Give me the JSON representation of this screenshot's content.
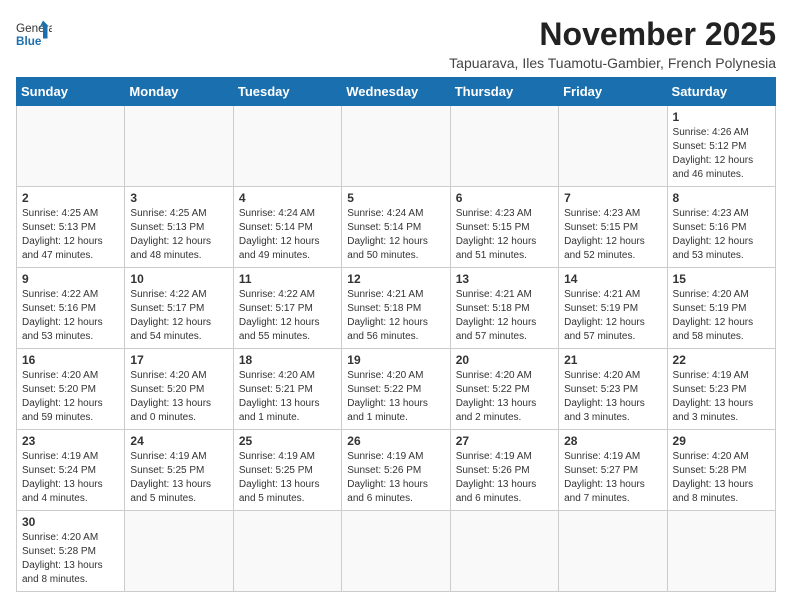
{
  "header": {
    "logo_line1": "General",
    "logo_line2": "Blue",
    "month_title": "November 2025",
    "subtitle": "Tapuarava, Iles Tuamotu-Gambier, French Polynesia"
  },
  "weekdays": [
    "Sunday",
    "Monday",
    "Tuesday",
    "Wednesday",
    "Thursday",
    "Friday",
    "Saturday"
  ],
  "weeks": [
    [
      {
        "day": "",
        "info": ""
      },
      {
        "day": "",
        "info": ""
      },
      {
        "day": "",
        "info": ""
      },
      {
        "day": "",
        "info": ""
      },
      {
        "day": "",
        "info": ""
      },
      {
        "day": "",
        "info": ""
      },
      {
        "day": "1",
        "info": "Sunrise: 4:26 AM\nSunset: 5:12 PM\nDaylight: 12 hours and 46 minutes."
      }
    ],
    [
      {
        "day": "2",
        "info": "Sunrise: 4:25 AM\nSunset: 5:13 PM\nDaylight: 12 hours and 47 minutes."
      },
      {
        "day": "3",
        "info": "Sunrise: 4:25 AM\nSunset: 5:13 PM\nDaylight: 12 hours and 48 minutes."
      },
      {
        "day": "4",
        "info": "Sunrise: 4:24 AM\nSunset: 5:14 PM\nDaylight: 12 hours and 49 minutes."
      },
      {
        "day": "5",
        "info": "Sunrise: 4:24 AM\nSunset: 5:14 PM\nDaylight: 12 hours and 50 minutes."
      },
      {
        "day": "6",
        "info": "Sunrise: 4:23 AM\nSunset: 5:15 PM\nDaylight: 12 hours and 51 minutes."
      },
      {
        "day": "7",
        "info": "Sunrise: 4:23 AM\nSunset: 5:15 PM\nDaylight: 12 hours and 52 minutes."
      },
      {
        "day": "8",
        "info": "Sunrise: 4:23 AM\nSunset: 5:16 PM\nDaylight: 12 hours and 53 minutes."
      }
    ],
    [
      {
        "day": "9",
        "info": "Sunrise: 4:22 AM\nSunset: 5:16 PM\nDaylight: 12 hours and 53 minutes."
      },
      {
        "day": "10",
        "info": "Sunrise: 4:22 AM\nSunset: 5:17 PM\nDaylight: 12 hours and 54 minutes."
      },
      {
        "day": "11",
        "info": "Sunrise: 4:22 AM\nSunset: 5:17 PM\nDaylight: 12 hours and 55 minutes."
      },
      {
        "day": "12",
        "info": "Sunrise: 4:21 AM\nSunset: 5:18 PM\nDaylight: 12 hours and 56 minutes."
      },
      {
        "day": "13",
        "info": "Sunrise: 4:21 AM\nSunset: 5:18 PM\nDaylight: 12 hours and 57 minutes."
      },
      {
        "day": "14",
        "info": "Sunrise: 4:21 AM\nSunset: 5:19 PM\nDaylight: 12 hours and 57 minutes."
      },
      {
        "day": "15",
        "info": "Sunrise: 4:20 AM\nSunset: 5:19 PM\nDaylight: 12 hours and 58 minutes."
      }
    ],
    [
      {
        "day": "16",
        "info": "Sunrise: 4:20 AM\nSunset: 5:20 PM\nDaylight: 12 hours and 59 minutes."
      },
      {
        "day": "17",
        "info": "Sunrise: 4:20 AM\nSunset: 5:20 PM\nDaylight: 13 hours and 0 minutes."
      },
      {
        "day": "18",
        "info": "Sunrise: 4:20 AM\nSunset: 5:21 PM\nDaylight: 13 hours and 1 minute."
      },
      {
        "day": "19",
        "info": "Sunrise: 4:20 AM\nSunset: 5:22 PM\nDaylight: 13 hours and 1 minute."
      },
      {
        "day": "20",
        "info": "Sunrise: 4:20 AM\nSunset: 5:22 PM\nDaylight: 13 hours and 2 minutes."
      },
      {
        "day": "21",
        "info": "Sunrise: 4:20 AM\nSunset: 5:23 PM\nDaylight: 13 hours and 3 minutes."
      },
      {
        "day": "22",
        "info": "Sunrise: 4:19 AM\nSunset: 5:23 PM\nDaylight: 13 hours and 3 minutes."
      }
    ],
    [
      {
        "day": "23",
        "info": "Sunrise: 4:19 AM\nSunset: 5:24 PM\nDaylight: 13 hours and 4 minutes."
      },
      {
        "day": "24",
        "info": "Sunrise: 4:19 AM\nSunset: 5:25 PM\nDaylight: 13 hours and 5 minutes."
      },
      {
        "day": "25",
        "info": "Sunrise: 4:19 AM\nSunset: 5:25 PM\nDaylight: 13 hours and 5 minutes."
      },
      {
        "day": "26",
        "info": "Sunrise: 4:19 AM\nSunset: 5:26 PM\nDaylight: 13 hours and 6 minutes."
      },
      {
        "day": "27",
        "info": "Sunrise: 4:19 AM\nSunset: 5:26 PM\nDaylight: 13 hours and 6 minutes."
      },
      {
        "day": "28",
        "info": "Sunrise: 4:19 AM\nSunset: 5:27 PM\nDaylight: 13 hours and 7 minutes."
      },
      {
        "day": "29",
        "info": "Sunrise: 4:20 AM\nSunset: 5:28 PM\nDaylight: 13 hours and 8 minutes."
      }
    ],
    [
      {
        "day": "30",
        "info": "Sunrise: 4:20 AM\nSunset: 5:28 PM\nDaylight: 13 hours and 8 minutes."
      },
      {
        "day": "",
        "info": ""
      },
      {
        "day": "",
        "info": ""
      },
      {
        "day": "",
        "info": ""
      },
      {
        "day": "",
        "info": ""
      },
      {
        "day": "",
        "info": ""
      },
      {
        "day": "",
        "info": ""
      }
    ]
  ]
}
